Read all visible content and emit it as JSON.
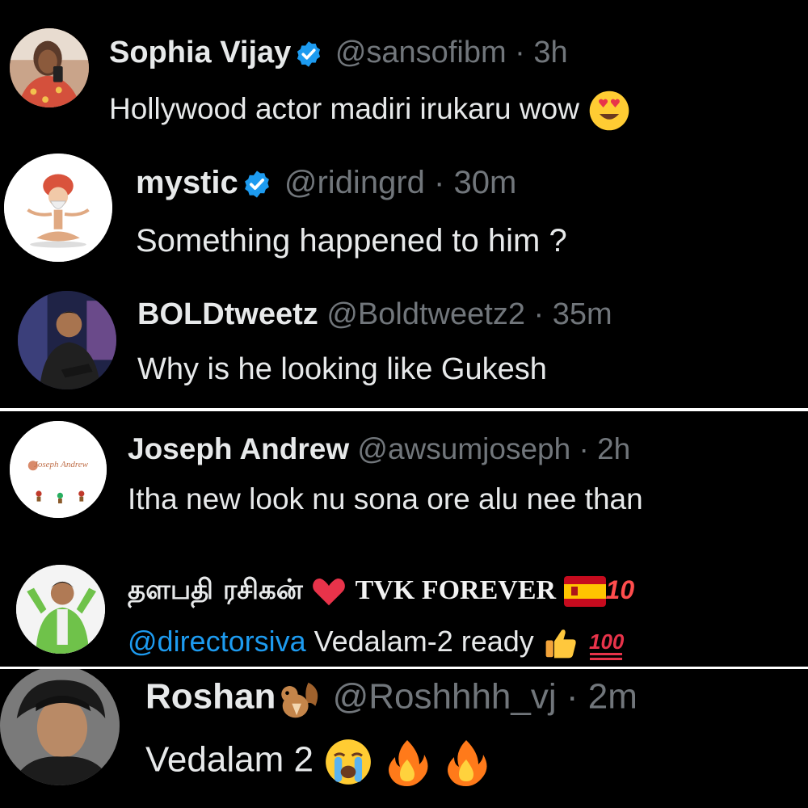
{
  "replies": [
    {
      "name": "Sophia Vijay",
      "verified": true,
      "handle": "@sansofibm",
      "separator": "·",
      "time": "3h",
      "text": "Hollywood actor madiri irukaru wow",
      "emojis": [
        "heart-eyes-emoji"
      ]
    },
    {
      "name": "mystic",
      "verified": true,
      "handle": "@ridingrd",
      "separator": "·",
      "time": "30m",
      "text": "Something happened to him ?"
    },
    {
      "name": "BOLDtweetz",
      "verified": false,
      "handle": "@Boldtweetz2",
      "separator": "·",
      "time": "35m",
      "text": "Why is he looking like Gukesh"
    },
    {
      "name": "Joseph Andrew",
      "verified": false,
      "handle": "@awsumjoseph",
      "separator": "·",
      "time": "2h",
      "text": "Itha new look nu sona ore alu nee than",
      "avatar_logo_text": "Joseph Andrew"
    },
    {
      "name": "தளபதி ரசிகன்",
      "name_suffix": "TVK FOREVER",
      "name_suffix_trail": "10",
      "verified": false,
      "mention": "@directorsiva",
      "text": "Vedalam-2 ready",
      "emojis": [
        "red-heart-emoji",
        "spain-flag-emoji",
        "thumbs-up-emoji",
        "hundred-points-emoji"
      ]
    },
    {
      "name": "Roshan",
      "verified": false,
      "handle": "@Roshhhh_vj",
      "separator": "·",
      "time": "2m",
      "text": "Vedalam 2",
      "emojis": [
        "chipmunk-emoji",
        "loudly-crying-emoji",
        "fire-emoji",
        "fire-emoji"
      ]
    }
  ],
  "colors": {
    "background": "#000000",
    "primary_text": "#e7e9ea",
    "secondary_text": "#71767b",
    "verified_badge": "#1d9bf0",
    "mention": "#1d9bf0",
    "divider": "#ffffff"
  }
}
